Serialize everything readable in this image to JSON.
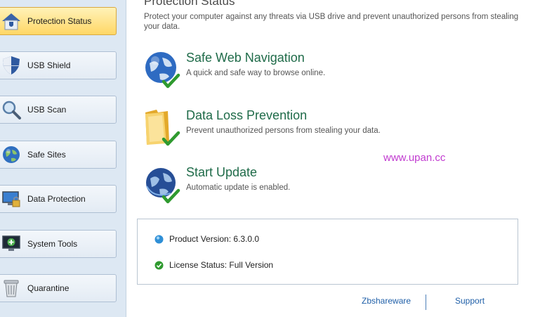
{
  "sidebar": {
    "items": [
      {
        "label": "Protection Status",
        "icon": "home-shield-icon",
        "active": true
      },
      {
        "label": "USB Shield",
        "icon": "shield-icon",
        "active": false
      },
      {
        "label": "USB Scan",
        "icon": "magnifier-icon",
        "active": false
      },
      {
        "label": "Safe Sites",
        "icon": "globe-icon",
        "active": false
      },
      {
        "label": "Data Protection",
        "icon": "monitor-lock-icon",
        "active": false
      },
      {
        "label": "System Tools",
        "icon": "monitor-tools-icon",
        "active": false
      },
      {
        "label": "Quarantine",
        "icon": "trash-bin-icon",
        "active": false
      }
    ]
  },
  "main": {
    "title": "Protection Status",
    "description": "Protect your computer against any threats via USB drive and prevent unauthorized persons from stealing your data.",
    "features": [
      {
        "title": "Safe Web Navigation",
        "description": "A quick and safe way to browse online.",
        "icon": "globe-check-icon"
      },
      {
        "title": "Data Loss Prevention",
        "description": "Prevent unauthorized persons from stealing your data.",
        "icon": "folder-check-icon"
      },
      {
        "title": "Start Update",
        "description": "Automatic update is enabled.",
        "icon": "globe-update-check-icon"
      }
    ],
    "watermark": "www.upan.cc",
    "info": {
      "product_version_label": "Product Version:",
      "product_version_value": "6.3.0.0",
      "license_status_label": "License Status:",
      "license_status_value": "Full Version"
    }
  },
  "footer": {
    "brand_link": "Zbshareware",
    "support_link": "Support"
  },
  "colors": {
    "accent_active": "#ffd766",
    "feature_title": "#1f6b49",
    "link": "#1f5fa8",
    "watermark": "#c13bd0",
    "sidebar_bg": "#dde8f3"
  }
}
